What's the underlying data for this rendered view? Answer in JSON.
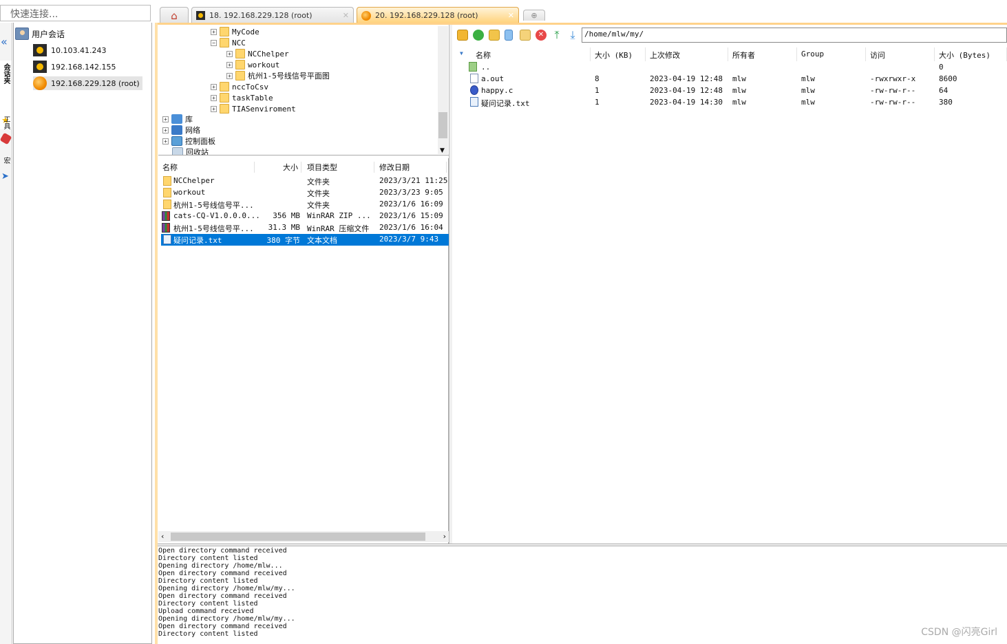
{
  "quick_connect": {
    "placeholder": "快速连接..."
  },
  "side_strip": {
    "tab_sessions": "会话夹",
    "tab_tools": "工具",
    "tab_macros": "宏"
  },
  "sessions": {
    "root_label": "用户会话",
    "items": [
      {
        "label": "10.103.41.243",
        "icon": "key-icon"
      },
      {
        "label": "192.168.142.155",
        "icon": "key-icon"
      },
      {
        "label": "192.168.229.128 (root)",
        "icon": "mobaxterm-icon"
      }
    ]
  },
  "tabs": [
    {
      "label": "18. 192.168.229.128 (root)",
      "icon": "key-icon"
    },
    {
      "label": "20. 192.168.229.128 (root)",
      "icon": "orange-icon"
    }
  ],
  "tab_close": "✕",
  "local_tree": [
    {
      "label": "MyCode",
      "expander": "+"
    },
    {
      "label": "NCC",
      "expander": "−"
    },
    {
      "label": "NCChelper",
      "expander": "+"
    },
    {
      "label": "workout",
      "expander": "+"
    },
    {
      "label": "杭州1-5号线信号平面图",
      "expander": "+"
    },
    {
      "label": "nccToCsv",
      "expander": "+"
    },
    {
      "label": "taskTable",
      "expander": "+"
    },
    {
      "label": "TIASenviroment",
      "expander": "+"
    },
    {
      "label": "库",
      "expander": "+"
    },
    {
      "label": "网络",
      "expander": "+"
    },
    {
      "label": "控制面板",
      "expander": "+"
    },
    {
      "label": "回收站",
      "expander": ""
    }
  ],
  "local_list": {
    "headers": [
      "名称",
      "大小",
      "项目类型",
      "修改日期"
    ],
    "rows": [
      {
        "name": "NCChelper",
        "size": "",
        "type": "文件夹",
        "date": "2023/3/21 11:25",
        "icon": "folder"
      },
      {
        "name": "workout",
        "size": "",
        "type": "文件夹",
        "date": "2023/3/23 9:05",
        "icon": "folder"
      },
      {
        "name": "杭州1-5号线信号平...",
        "size": "",
        "type": "文件夹",
        "date": "2023/1/6 16:09",
        "icon": "folder"
      },
      {
        "name": "cats-CQ-V1.0.0.0...",
        "size": "356 MB",
        "type": "WinRAR ZIP ...",
        "date": "2023/1/6 15:09",
        "icon": "rar"
      },
      {
        "name": "杭州1-5号线信号平...",
        "size": "31.3 MB",
        "type": "WinRAR 压缩文件",
        "date": "2023/1/6 16:04",
        "icon": "rar"
      },
      {
        "name": "疑问记录.txt",
        "size": "380 字节",
        "type": "文本文档",
        "date": "2023/3/7 9:43",
        "icon": "txt",
        "selected": true
      }
    ]
  },
  "remote": {
    "path": "/home/mlw/my/",
    "headers": [
      "名称",
      "大小 (KB)",
      "上次修改",
      "所有者",
      "Group",
      "访问",
      "大小 (Bytes)"
    ],
    "rows": [
      {
        "name": "..",
        "size_kb": "",
        "modified": "",
        "owner": "",
        "group": "",
        "access": "",
        "bytes": "0",
        "icon": "up"
      },
      {
        "name": "a.out",
        "size_kb": "8",
        "modified": "2023-04-19 12:48",
        "owner": "mlw",
        "group": "mlw",
        "access": "-rwxrwxr-x",
        "bytes": "8600",
        "icon": "file"
      },
      {
        "name": "happy.c",
        "size_kb": "1",
        "modified": "2023-04-19 12:48",
        "owner": "mlw",
        "group": "mlw",
        "access": "-rw-rw-r--",
        "bytes": "64",
        "icon": "c"
      },
      {
        "name": "疑问记录.txt",
        "size_kb": "1",
        "modified": "2023-04-19 14:30",
        "owner": "mlw",
        "group": "mlw",
        "access": "-rw-rw-r--",
        "bytes": "380",
        "icon": "txt"
      }
    ]
  },
  "log_lines": [
    "Open directory command received",
    "Directory content listed",
    "Opening directory /home/mlw...",
    "Open directory command received",
    "Directory content listed",
    "Opening directory /home/mlw/my...",
    "Open directory command received",
    "Directory content listed",
    "Upload command received",
    "Opening directory /home/mlw/my...",
    "Open directory command received",
    "Directory content listed"
  ],
  "watermark": "CSDN @闪亮Girl",
  "colors": {
    "selection": "#0078d7",
    "active_tab": "#ffd27a",
    "frame": "#ffd28a"
  }
}
